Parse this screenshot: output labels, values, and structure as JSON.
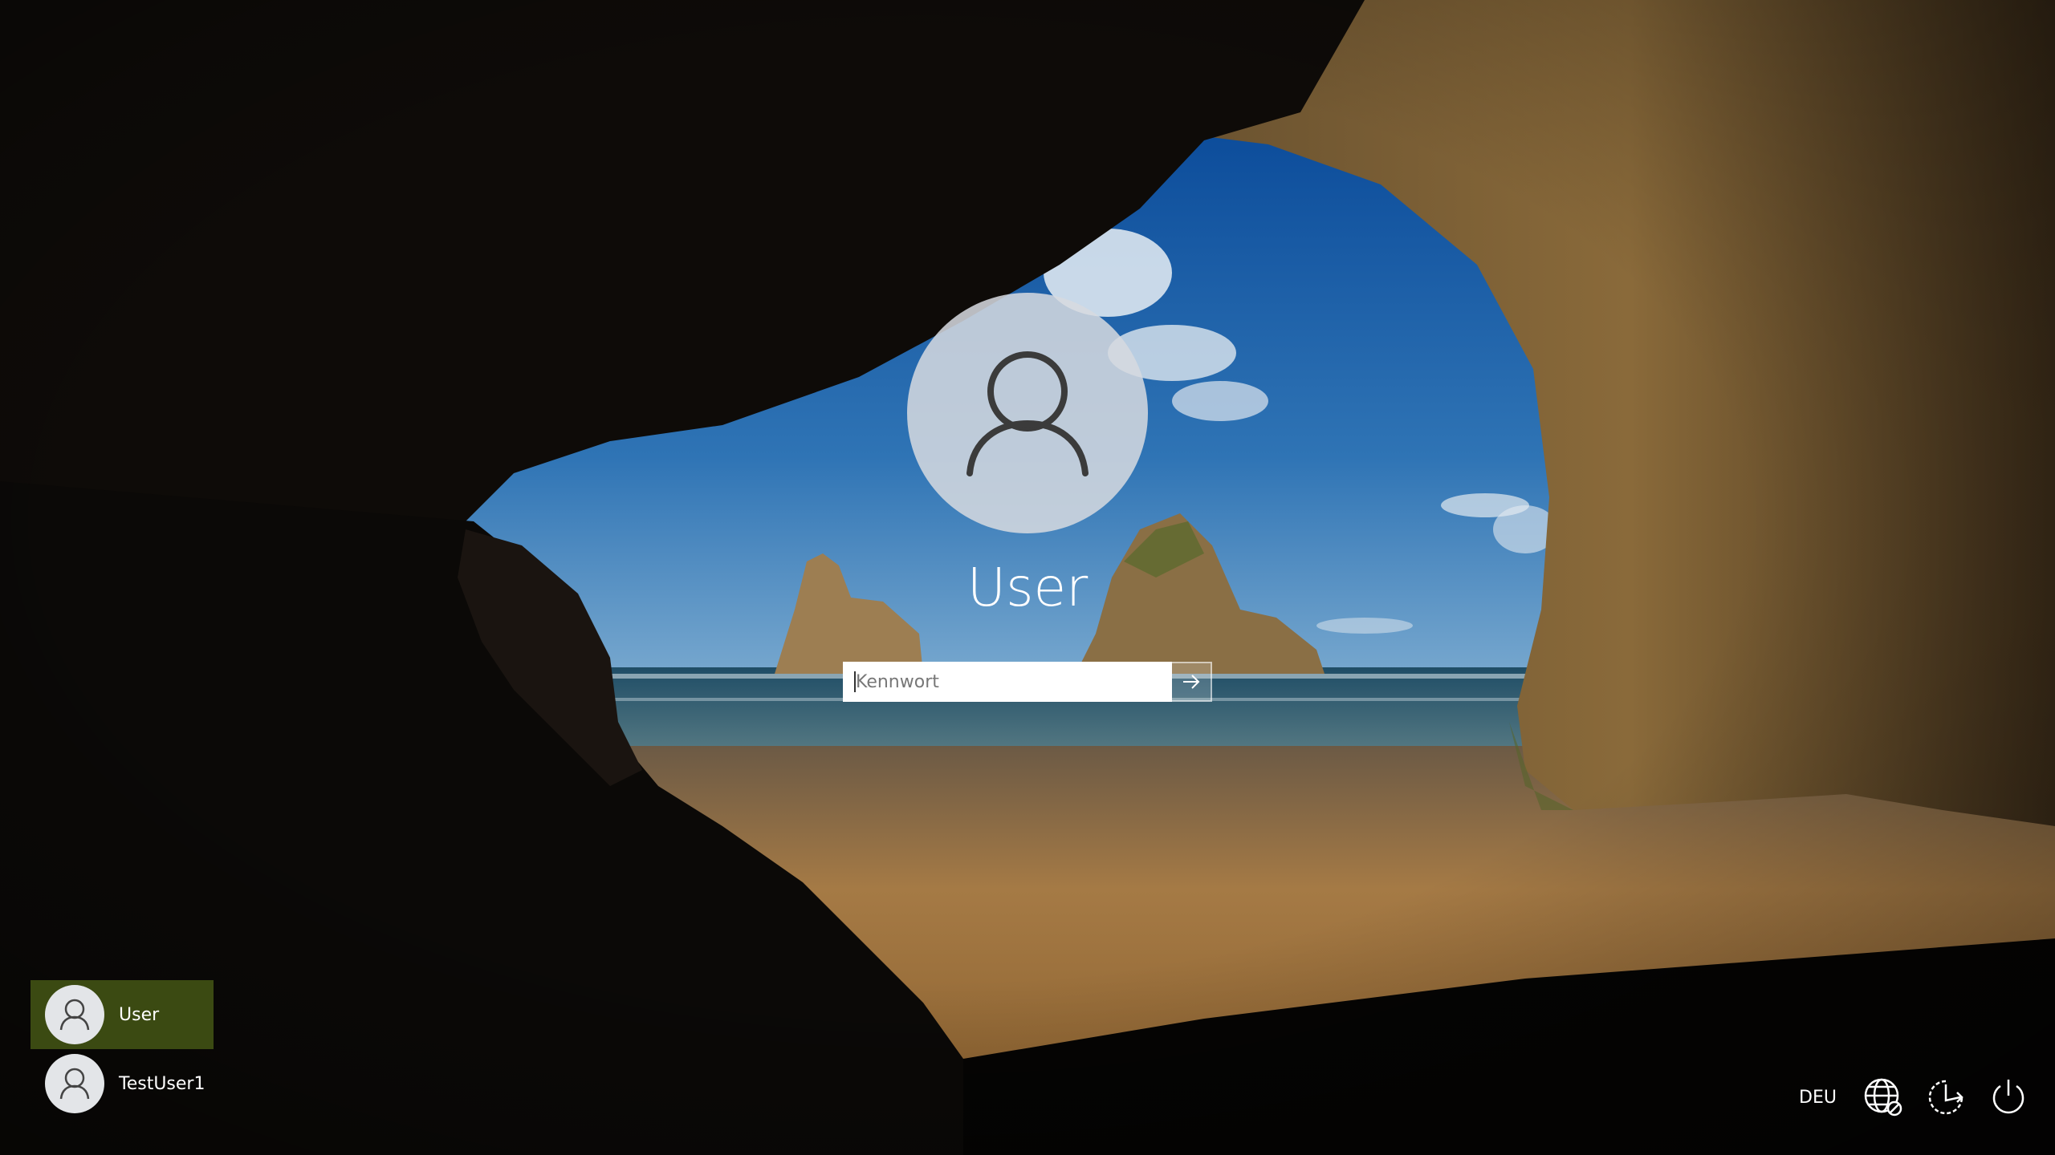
{
  "login": {
    "username": "User",
    "password_placeholder": "Kennwort"
  },
  "users": [
    {
      "name": "User",
      "selected": true
    },
    {
      "name": "TestUser1",
      "selected": false
    }
  ],
  "tray": {
    "language": "DEU"
  },
  "colors": {
    "selected_user_bg": "#3b4a12",
    "sky_blue": "#2f74b5",
    "sand": "#a57a45"
  }
}
